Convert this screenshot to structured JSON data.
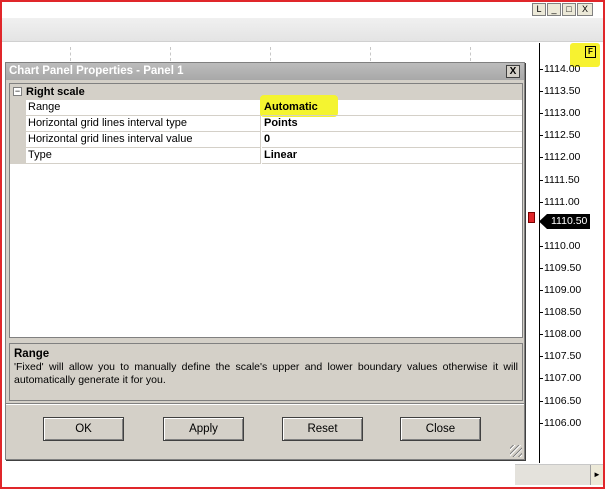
{
  "window": {
    "btn_l": "L",
    "btn_min": "_",
    "btn_max": "□",
    "btn_close": "X"
  },
  "chart": {
    "flag_label": "F",
    "price_labels": [
      "1114.00",
      "1113.50",
      "1113.00",
      "1112.50",
      "1112.00",
      "1111.50",
      "1111.00",
      "1110.00",
      "1109.50",
      "1109.00",
      "1108.50",
      "1108.00",
      "1107.50",
      "1107.00",
      "1106.50",
      "1106.00"
    ],
    "current_price": "1110.50",
    "highlight_color": "#f4f430",
    "marker_color": "#e0262a"
  },
  "dialog": {
    "title": "Chart Panel Properties - Panel 1",
    "close_label": "X",
    "category": {
      "collapse_symbol": "⊟",
      "label": "Right scale"
    },
    "properties": [
      {
        "name": "Range",
        "value": "Automatic"
      },
      {
        "name": "Horizontal grid lines interval type",
        "value": "Points"
      },
      {
        "name": "Horizontal grid lines interval value",
        "value": "0"
      },
      {
        "name": "Type",
        "value": "Linear"
      }
    ],
    "description": {
      "title": "Range",
      "text": "'Fixed' will allow you to manually define the scale's upper and lower boundary values otherwise it will automatically generate it for you."
    },
    "buttons": {
      "ok": "OK",
      "apply": "Apply",
      "reset": "Reset",
      "close": "Close"
    }
  }
}
